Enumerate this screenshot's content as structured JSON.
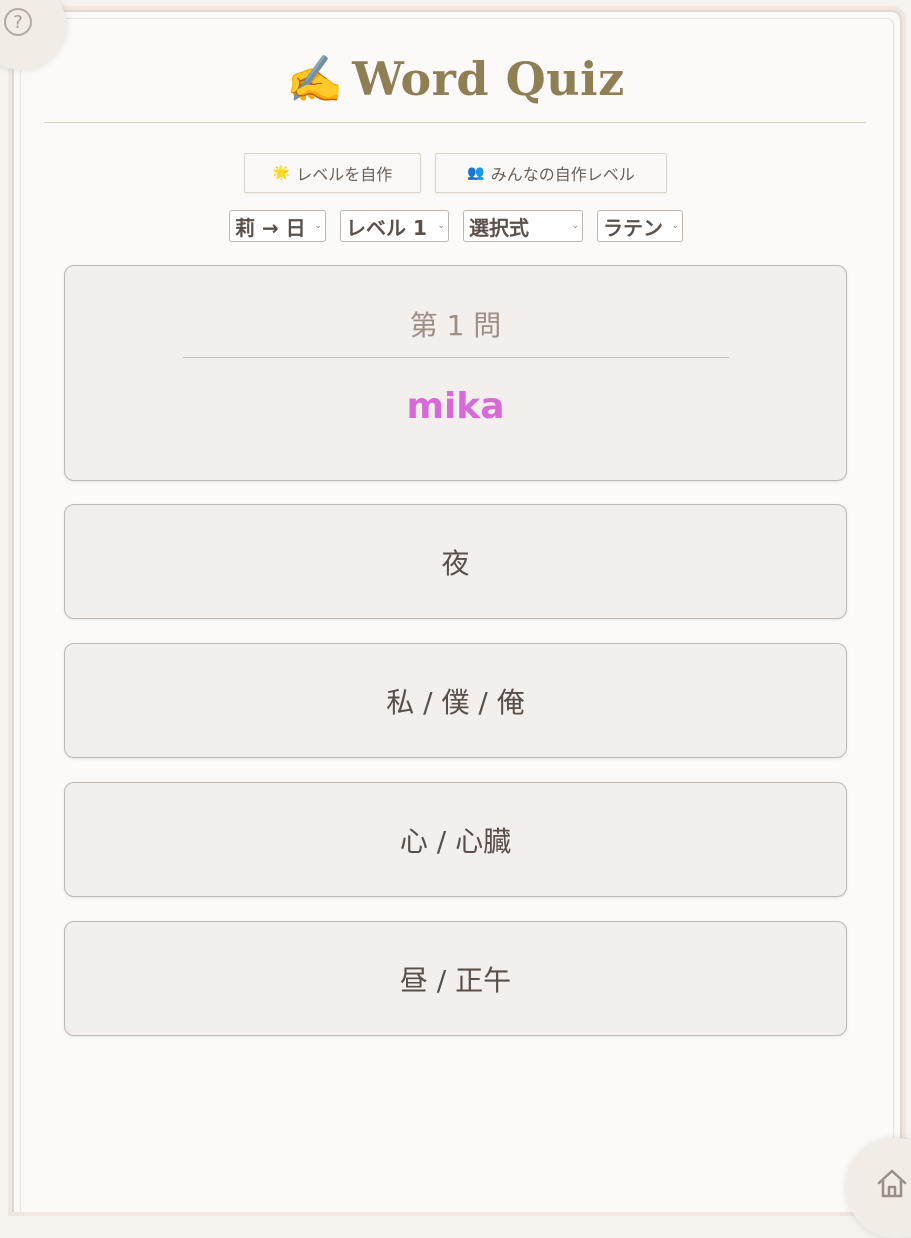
{
  "app": {
    "title_emoji": "✍️",
    "title": "Word Quiz"
  },
  "toolbar": {
    "create_level_icon": "🌟",
    "create_level_label": "レベルを自作",
    "community_levels_icon": "👥",
    "community_levels_label": "みんなの自作レベル"
  },
  "selects": {
    "direction": "莉 → 日",
    "level": "レベル 1",
    "mode": "選択式",
    "script": "ラテン"
  },
  "question": {
    "number_label": "第 1 問",
    "word": "mika",
    "word_color": "#d76ad6"
  },
  "answers": [
    {
      "label": "夜"
    },
    {
      "label": "私 / 僕 / 俺"
    },
    {
      "label": "心 / 心臓"
    },
    {
      "label": "昼 / 正午"
    }
  ],
  "icons": {
    "help": "help-icon",
    "home": "home-icon"
  },
  "help_glyph": "?"
}
